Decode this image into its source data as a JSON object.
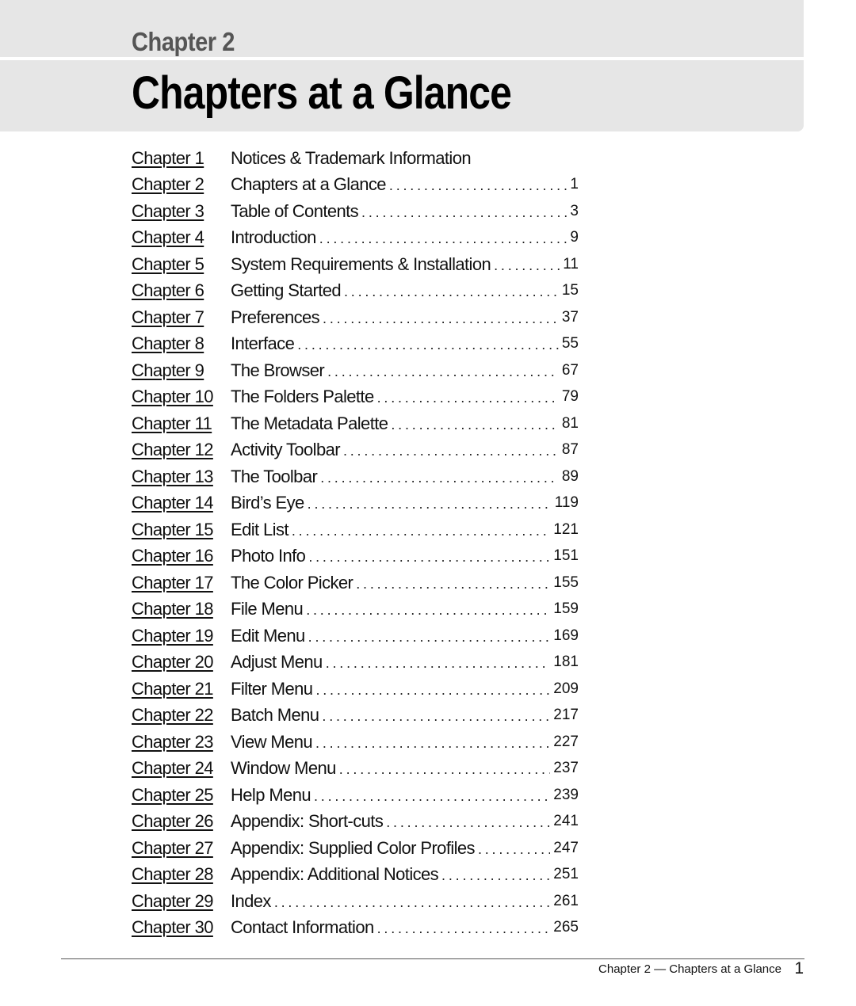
{
  "header": {
    "kicker": "Chapter 2",
    "title": "Chapters at a Glance"
  },
  "toc": [
    {
      "chapter": "Chapter 1",
      "title": "Notices & Trademark Information",
      "page": ""
    },
    {
      "chapter": "Chapter 2",
      "title": "Chapters at a Glance",
      "page": "1"
    },
    {
      "chapter": "Chapter 3",
      "title": "Table of Contents",
      "page": "3"
    },
    {
      "chapter": "Chapter 4",
      "title": "Introduction",
      "page": "9"
    },
    {
      "chapter": "Chapter 5",
      "title": "System Requirements & Installation",
      "page": "11"
    },
    {
      "chapter": "Chapter 6",
      "title": "Getting Started",
      "page": "15"
    },
    {
      "chapter": "Chapter 7",
      "title": "Preferences",
      "page": "37"
    },
    {
      "chapter": "Chapter 8",
      "title": "Interface",
      "page": "55"
    },
    {
      "chapter": "Chapter 9",
      "title": "The Browser",
      "page": "67"
    },
    {
      "chapter": "Chapter 10",
      "title": "The Folders Palette",
      "page": "79"
    },
    {
      "chapter": "Chapter 11",
      "title": "The Metadata Palette",
      "page": "81"
    },
    {
      "chapter": "Chapter 12",
      "title": "Activity Toolbar",
      "page": "87"
    },
    {
      "chapter": "Chapter 13",
      "title": "The Toolbar",
      "page": "89"
    },
    {
      "chapter": "Chapter 14",
      "title": "Bird’s Eye",
      "page": "119"
    },
    {
      "chapter": "Chapter 15",
      "title": "Edit List",
      "page": "121"
    },
    {
      "chapter": "Chapter 16",
      "title": "Photo Info",
      "page": "151"
    },
    {
      "chapter": "Chapter 17",
      "title": "The Color Picker",
      "page": "155"
    },
    {
      "chapter": "Chapter 18",
      "title": "File Menu",
      "page": "159"
    },
    {
      "chapter": "Chapter 19",
      "title": "Edit Menu",
      "page": "169"
    },
    {
      "chapter": "Chapter 20",
      "title": "Adjust Menu",
      "page": "181"
    },
    {
      "chapter": "Chapter 21",
      "title": "Filter Menu",
      "page": "209"
    },
    {
      "chapter": "Chapter 22",
      "title": "Batch Menu",
      "page": "217"
    },
    {
      "chapter": "Chapter 23",
      "title": "View Menu",
      "page": "227"
    },
    {
      "chapter": "Chapter 24",
      "title": "Window Menu",
      "page": "237"
    },
    {
      "chapter": "Chapter 25",
      "title": "Help Menu",
      "page": "239"
    },
    {
      "chapter": "Chapter 26",
      "title": "Appendix: Short-cuts",
      "page": "241"
    },
    {
      "chapter": "Chapter 27",
      "title": "Appendix: Supplied Color Profiles",
      "page": "247"
    },
    {
      "chapter": "Chapter 28",
      "title": "Appendix: Additional Notices",
      "page": "251"
    },
    {
      "chapter": "Chapter 29",
      "title": "Index",
      "page": "261"
    },
    {
      "chapter": "Chapter 30",
      "title": "Contact Information",
      "page": "265"
    }
  ],
  "footer": {
    "running_title": "Chapter 2 — Chapters at a Glance",
    "page_number": "1"
  }
}
